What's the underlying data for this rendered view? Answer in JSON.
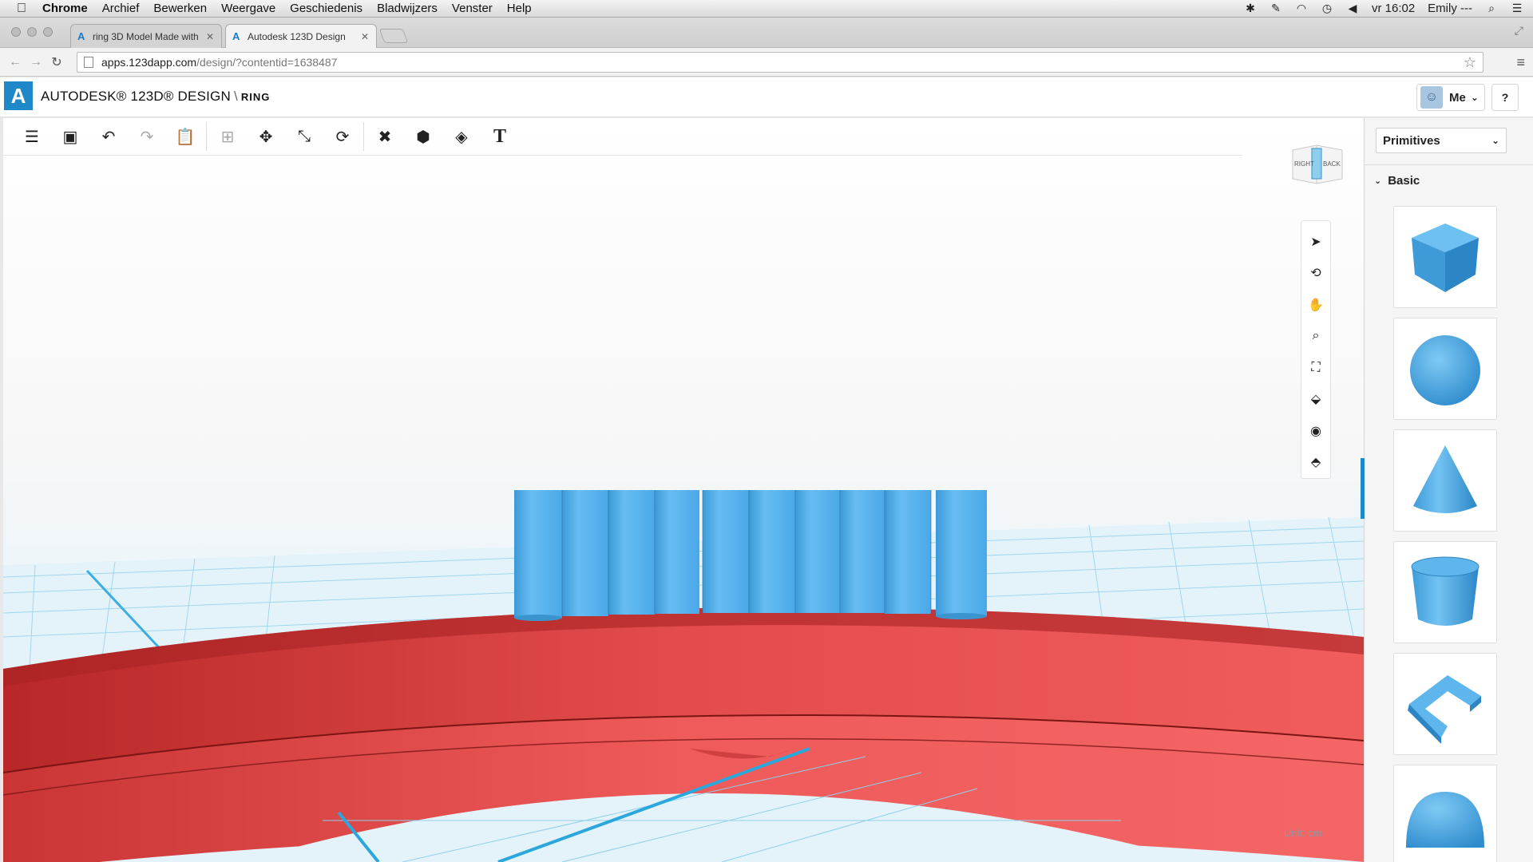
{
  "menubar": {
    "app": "Chrome",
    "items": [
      "Archief",
      "Bewerken",
      "Weergave",
      "Geschiedenis",
      "Bladwijzers",
      "Venster",
      "Help"
    ],
    "clock": "vr 16:02",
    "user": "Emily ---"
  },
  "browser": {
    "tabs": [
      {
        "title": "ring 3D Model Made with",
        "active": false
      },
      {
        "title": "Autodesk 123D Design",
        "active": true
      }
    ],
    "url_host": "apps.123dapp.com",
    "url_path": "/design/?contentid=1638487"
  },
  "app": {
    "brand": "AUTODESK® 123D® DESIGN",
    "separator": "\\",
    "project": "RING",
    "user_menu": "Me",
    "help": "?"
  },
  "viewcube": {
    "right": "RIGHT",
    "back": "BACK"
  },
  "viewport": {
    "unit_label": "Unit:  cm"
  },
  "panel": {
    "dropdown": "Primitives",
    "section": "Basic",
    "primitives": [
      "box",
      "sphere",
      "cone",
      "cylinder",
      "polygon-bracket",
      "hemisphere"
    ]
  },
  "colors": {
    "accent": "#1f88c9",
    "primitive_blue": "#4aa8e8",
    "ring_red": "#e85555",
    "grid_blue": "#6cc3e8"
  }
}
